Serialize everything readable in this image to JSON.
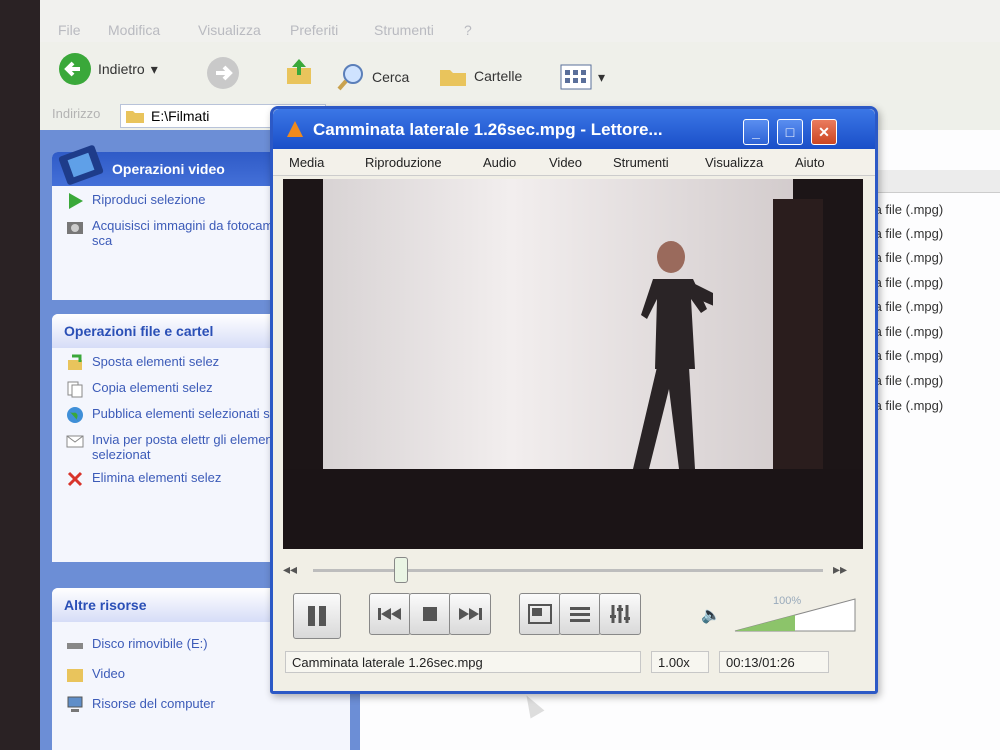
{
  "explorer": {
    "menu": [
      "File",
      "Modifica",
      "Visualizza",
      "Preferiti",
      "Strumenti",
      "?"
    ],
    "toolbar": {
      "back": "Indietro",
      "search": "Cerca",
      "folders": "Cartelle"
    },
    "address": {
      "label": "Indirizzo",
      "path": "E:\\Filmati"
    },
    "panels": {
      "video": {
        "title": "Operazioni video",
        "items": [
          "Riproduci selezione",
          "Acquisisci immagini da fotocamera o uno sca"
        ]
      },
      "files": {
        "title": "Operazioni file e cartel",
        "items": [
          "Sposta elementi selez",
          "Copia elementi selez",
          "Pubblica elementi selezionati sul Web",
          "Invia per posta elettr gli elementi selezionat",
          "Elimina elementi selez"
        ]
      },
      "other": {
        "title": "Altre risorse",
        "items": [
          "Disco rimovibile (E:)",
          "Video",
          "Risorse del computer"
        ]
      }
    },
    "file_rows": [
      "nedia file (.mpg)",
      "nedia file (.mpg)",
      "nedia file (.mpg)",
      "nedia file (.mpg)",
      "nedia file (.mpg)",
      "nedia file (.mpg)",
      "nedia file (.mpg)",
      "nedia file (.mpg)",
      "nedia file (.mpg)"
    ]
  },
  "vlc": {
    "title": "Camminata laterale 1.26sec.mpg - Lettore...",
    "menu": [
      "Media",
      "Riproduzione",
      "Audio",
      "Video",
      "Strumenti",
      "Visualizza",
      "Aiuto"
    ],
    "progress": 0.17,
    "volume": "100%",
    "status": {
      "file": "Camminata laterale 1.26sec.mpg",
      "speed": "1.00x",
      "time": "00:13/01:26"
    }
  }
}
